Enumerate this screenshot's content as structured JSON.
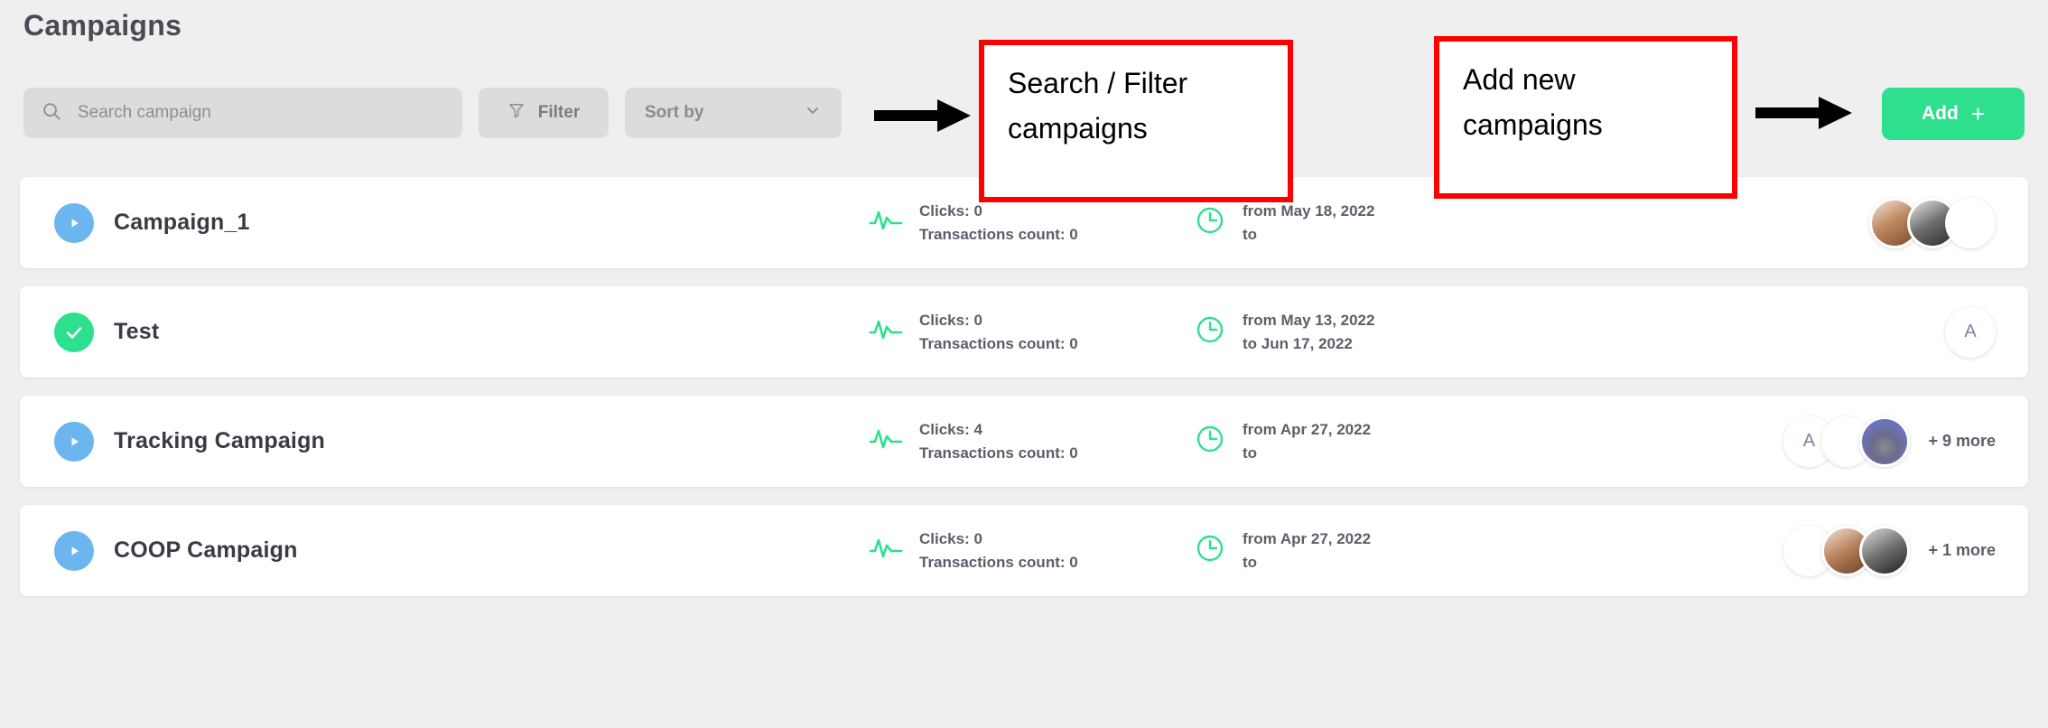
{
  "page": {
    "title": "Campaigns",
    "accent_green": "#2ee08e",
    "accent_blue": "#6cb6ef",
    "annotation_red": "#ff0000",
    "background": "#efefef"
  },
  "toolbar": {
    "search_placeholder": "Search campaign",
    "search_value": "",
    "search_icon": "search-icon",
    "filter_label": "Filter",
    "filter_icon": "funnel-icon",
    "sort_label": "Sort by",
    "sort_icon": "chevron-down-icon",
    "add_label": "Add",
    "add_icon": "plus-icon"
  },
  "annotations": [
    {
      "id": "search-filter",
      "line1": "Search / Filter",
      "line2": "campaigns",
      "arrow": "right-arrow-icon"
    },
    {
      "id": "add-new",
      "line1": "Add new",
      "line2": "campaigns",
      "arrow": "right-arrow-icon"
    }
  ],
  "campaigns": [
    {
      "name": "Campaign_1",
      "status_icon": "play-icon",
      "status_color": "#6cb6ef",
      "clicks": "Clicks: 0",
      "transactions": "Transactions count: 0",
      "date_from": "from May 18, 2022",
      "date_to": "to",
      "avatars": [
        {
          "type": "photo",
          "style": "p1",
          "initial": ""
        },
        {
          "type": "photo",
          "style": "p2",
          "initial": ""
        },
        {
          "type": "blank",
          "style": "blank",
          "initial": ""
        }
      ],
      "more": ""
    },
    {
      "name": "Test",
      "status_icon": "check-icon",
      "status_color": "#2ee08e",
      "clicks": "Clicks: 0",
      "transactions": "Transactions count: 0",
      "date_from": "from May 13, 2022",
      "date_to": "to Jun 17, 2022",
      "avatars": [
        {
          "type": "initial",
          "style": "blank",
          "initial": "A"
        }
      ],
      "more": ""
    },
    {
      "name": "Tracking Campaign",
      "status_icon": "play-icon",
      "status_color": "#6cb6ef",
      "clicks": "Clicks: 4",
      "transactions": "Transactions count: 0",
      "date_from": "from Apr 27, 2022",
      "date_to": "to",
      "avatars": [
        {
          "type": "initial",
          "style": "blank",
          "initial": "A"
        },
        {
          "type": "blank",
          "style": "blank",
          "initial": ""
        },
        {
          "type": "photo",
          "style": "cartoon",
          "initial": ""
        }
      ],
      "more": "+ 9 more"
    },
    {
      "name": "COOP Campaign",
      "status_icon": "play-icon",
      "status_color": "#6cb6ef",
      "clicks": "Clicks: 0",
      "transactions": "Transactions count: 0",
      "date_from": "from Apr 27, 2022",
      "date_to": "to",
      "avatars": [
        {
          "type": "blank",
          "style": "blank",
          "initial": ""
        },
        {
          "type": "photo",
          "style": "p3",
          "initial": ""
        },
        {
          "type": "photo",
          "style": "p4",
          "initial": ""
        }
      ],
      "more": "+ 1 more"
    }
  ]
}
